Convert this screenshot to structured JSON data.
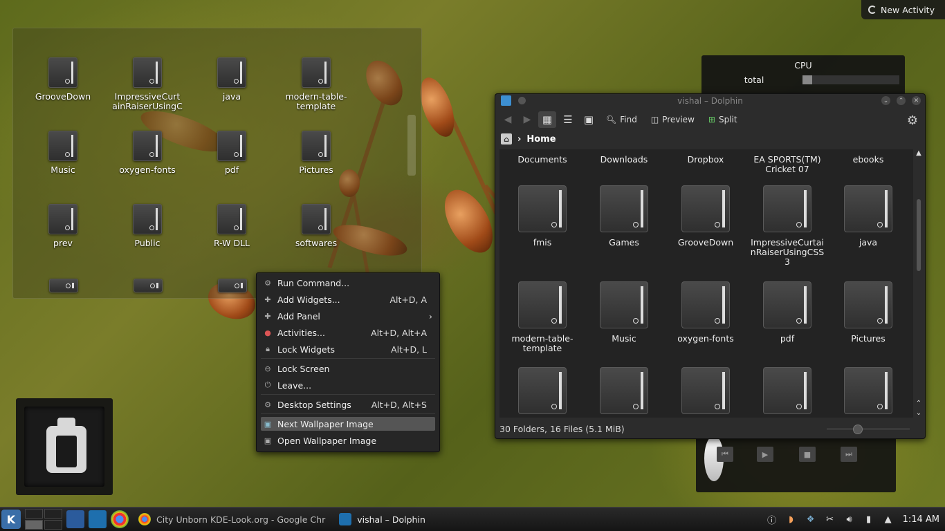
{
  "new_activity_label": "New Activity",
  "folder_view": {
    "items": [
      "GrooveDown",
      "ImpressiveCurtainRaiserUsingCSS3",
      "java",
      "modern-table-template",
      "Music",
      "oxygen-fonts",
      "pdf",
      "Pictures",
      "prev",
      "Public",
      "R-W DLL",
      "softwares"
    ],
    "display_names": [
      "GrooveDown",
      "ImpressiveCurt ainRaiserUsingC",
      "java",
      "modern-table- template",
      "Music",
      "oxygen-fonts",
      "pdf",
      "Pictures",
      "prev",
      "Public",
      "R-W DLL",
      "softwares"
    ]
  },
  "cpu": {
    "title": "CPU",
    "total_label": "total",
    "usage_fraction": 0.1
  },
  "context_menu": {
    "items": [
      {
        "label": "Run Command...",
        "shortcut": "",
        "icon": "run-icon"
      },
      {
        "label": "Add Widgets...",
        "shortcut": "Alt+D, A",
        "icon": "plus-icon"
      },
      {
        "label": "Add Panel",
        "shortcut": "",
        "icon": "plus-icon",
        "submenu": true
      },
      {
        "label": "Activities...",
        "shortcut": "Alt+D, Alt+A",
        "icon": "activities-icon"
      },
      {
        "label": "Lock Widgets",
        "shortcut": "Alt+D, L",
        "icon": "lock-icon"
      },
      {
        "label": "Lock Screen",
        "shortcut": "",
        "icon": "lock-screen-icon"
      },
      {
        "label": "Leave...",
        "shortcut": "",
        "icon": "power-icon"
      },
      {
        "label": "Desktop Settings",
        "shortcut": "Alt+D, Alt+S",
        "icon": "gear-icon"
      },
      {
        "label": "Next Wallpaper Image",
        "shortcut": "",
        "icon": "image-icon",
        "highlighted": true
      },
      {
        "label": "Open Wallpaper Image",
        "shortcut": "",
        "icon": "image-icon"
      }
    ]
  },
  "dolphin": {
    "title": "vishal – Dolphin",
    "toolbar": {
      "find": "Find",
      "preview": "Preview",
      "split": "Split"
    },
    "breadcrumb": "Home",
    "top_row": [
      "Documents",
      "Downloads",
      "Dropbox",
      "EA SPORTS(TM) Cricket 07",
      "ebooks"
    ],
    "row2": [
      "fmis",
      "Games",
      "GrooveDown",
      "ImpressiveCurtainRaiserUsingCSS3",
      "java"
    ],
    "row3": [
      "modern-table-template",
      "Music",
      "oxygen-fonts",
      "pdf",
      "Pictures"
    ],
    "status": "30 Folders, 16 Files (5.1 MiB)"
  },
  "taskbar": {
    "tasks": [
      {
        "label": "City Unborn KDE-Look.org - Google Chr",
        "icon": "chrome-icon"
      },
      {
        "label": "vishal – Dolphin",
        "icon": "dolphin-icon"
      }
    ],
    "clock": "1:14 AM"
  },
  "colors": {
    "accent": "#3d8fd1",
    "menu_bg": "#262626",
    "highlight": "#555555"
  }
}
